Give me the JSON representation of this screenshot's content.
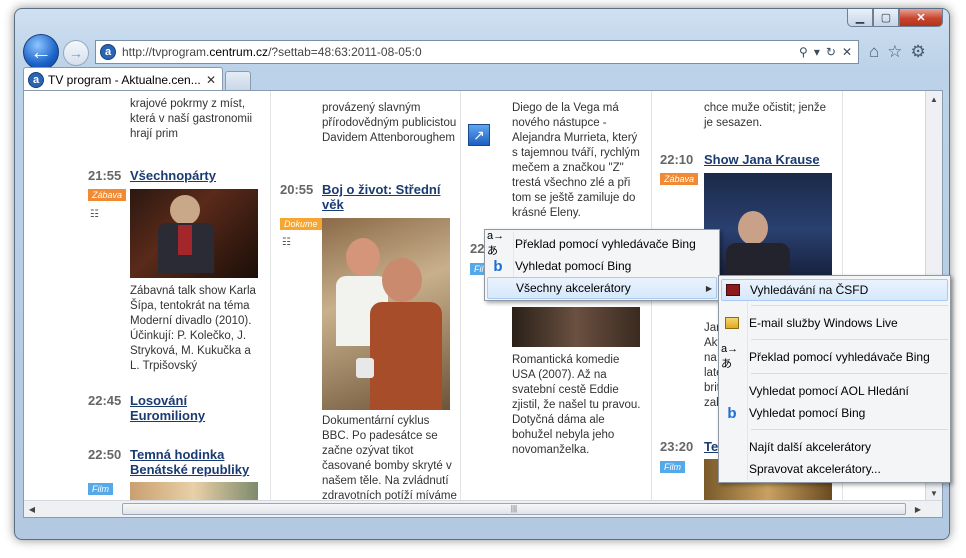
{
  "window": {
    "minimize": "▁",
    "maximize": "▢",
    "close": "✕"
  },
  "nav": {
    "back": "←",
    "forward": "→",
    "url_prefix": "http://tvprogram.",
    "url_domain": "centrum.cz",
    "url_suffix": "/?settab=48:63:2011-08-05:0",
    "search_glyph": "⚲",
    "compat_glyph": "▾",
    "refresh_glyph": "↻",
    "stop_glyph": "✕",
    "home_glyph": "⌂",
    "favorites_glyph": "☆",
    "tools_glyph": "⚙"
  },
  "tabs": {
    "active_label": "TV program - Aktualne.cen...",
    "close_glyph": "✕",
    "site_letter": "a"
  },
  "columns": {
    "c1": {
      "top_desc": "krajové pokrmy z míst, která v naší gastronomii hrají prim",
      "s1_time": "21:55",
      "s1_title": "Všechnopárty",
      "s1_badge": "Zábava",
      "s1_desc": "Zábavná talk show Karla Šípa, tentokrát na téma Moderní divadlo (2010). Účinkují: P. Kolečko, J. Stryková, M. Kukučka a L. Trpišovský",
      "s2_time": "22:45",
      "s2_title": "Losování Euromiliony",
      "s3_time": "22:50",
      "s3_title": "Temná hodinka Benátské republiky",
      "s3_badge": "Film"
    },
    "c2": {
      "top_desc": "provázený slavným přírodovědným publicistou Davidem Attenboroughem",
      "s1_time": "20:55",
      "s1_title": "Boj o život: Střední věk",
      "s1_badge": "Dokume",
      "s1_desc": "Dokumentární cyklus BBC. Po padesátce se začne ozývat tikot časované bomby skryté v našem těle. Na zvládnutí zdravotních potíží míváme však většinou ještě dosti rezerv"
    },
    "c3": {
      "top_desc": "Diego de la Vega má nového nástupce - Alejandra Murrieta, který s tajemnou tváří, rychlým mečem a značkou \"Z\" trestá všechno zlé a při tom se ještě zamiluje do krásné Eleny.",
      "s1_time": "22:",
      "s1_badge": "Fil",
      "s1_desc": "Romantická komedie USA (2007). Až na svatební cestě Eddie zjistil, že našel tu pravou. Dotyčná dáma ale bohužel nebyla jeho novomanželka."
    },
    "c4": {
      "top_desc": "chce muže očistit; jenže je sesazen.",
      "s1_time": "22:10",
      "s1_title": "Show Jana Krause",
      "s1_badge": "Zábava",
      "side_frag": "Jar\nAkt\nna\nlate\nbrit\nzab",
      "s2_time": "23:20",
      "s2_title": "Te",
      "s2_badge": "Film"
    }
  },
  "menu1": {
    "items": [
      {
        "icon": "a→あ",
        "label": "Překlad pomocí vyhledávače Bing"
      },
      {
        "icon": "b",
        "label": "Vyhledat pomocí Bing"
      },
      {
        "icon": "",
        "label": "Všechny akcelerátory"
      }
    ],
    "submenu_arrow": "▶"
  },
  "menu2": {
    "items": [
      {
        "label": "Vyhledávání na ČSFD"
      },
      {
        "label": "E-mail služby Windows Live"
      },
      {
        "label": "Překlad pomocí vyhledávače Bing"
      },
      {
        "label": "Vyhledat pomocí AOL Hledání"
      },
      {
        "label": "Vyhledat pomocí Bing"
      },
      {
        "label": "Najít další akcelerátory"
      },
      {
        "label": "Spravovat akcelerátory..."
      }
    ]
  },
  "colors": {
    "link": "#1a3b72",
    "badge_zabava": "#f08a34",
    "badge_film": "#56a9e8",
    "menu_highlight": "#d6e8fb"
  }
}
